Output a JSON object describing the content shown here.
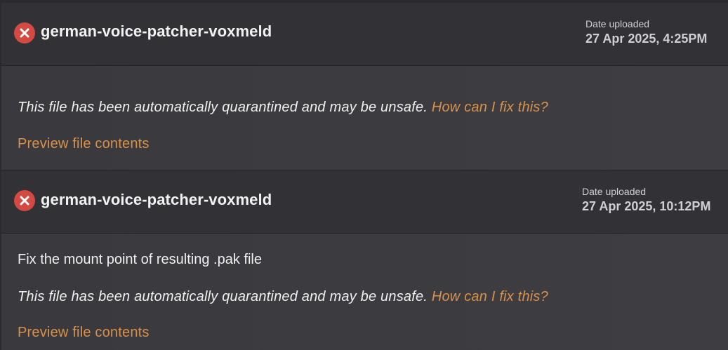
{
  "files": [
    {
      "name": "german-voice-patcher-voxmeld",
      "status_icon": "error-x-icon",
      "date_label": "Date uploaded",
      "date_value": "27 Apr 2025, 4:25PM",
      "description": "",
      "warning_text": "This file has been automatically quarantined and may be unsafe.",
      "fix_link": "How can I fix this?",
      "preview_link": "Preview file contents"
    },
    {
      "name": "german-voice-patcher-voxmeld",
      "status_icon": "error-x-icon",
      "date_label": "Date uploaded",
      "date_value": "27 Apr 2025, 10:12PM",
      "description": "Fix the mount point of resulting .pak file",
      "warning_text": "This file has been automatically quarantined and may be unsafe.",
      "fix_link": "How can I fix this?",
      "preview_link": "Preview file contents"
    }
  ],
  "colors": {
    "error": "#d24a42",
    "link": "#d9914a",
    "header_bg": "#323236",
    "body_bg": "#3b3b3f"
  }
}
